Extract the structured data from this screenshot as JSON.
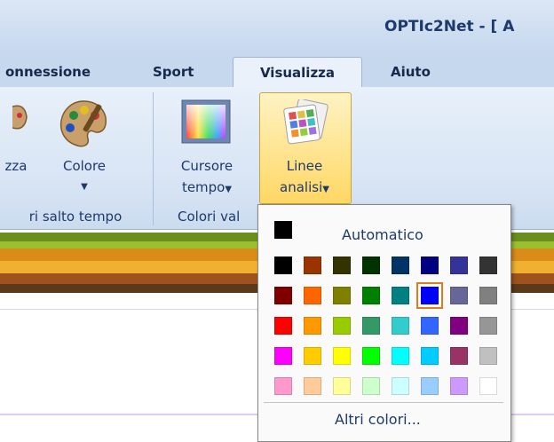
{
  "window": {
    "title": "OPTIc2Net - [ A"
  },
  "tabs": [
    {
      "label": "onnessione",
      "active": false
    },
    {
      "label": "Sport",
      "active": false
    },
    {
      "label": "Visualizza",
      "active": true
    },
    {
      "label": "Aiuto",
      "active": false
    }
  ],
  "ribbon": {
    "buttons": {
      "partial": "zza",
      "colore": "Colore",
      "cursore_line1": "Cursore",
      "cursore_line2": "tempo",
      "linee_line1": "Linee",
      "linee_line2": "analisi"
    },
    "groups": {
      "salto": "ri salto tempo",
      "colori": "Colori val"
    }
  },
  "color_popup": {
    "automatic_label": "Automatico",
    "more_colors_label": "Altri colori...",
    "automatic_color": "#000000",
    "selected_color": "#0000FF",
    "rows": [
      [
        "#000000",
        "#993300",
        "#333300",
        "#003300",
        "#003366",
        "#000080",
        "#333399",
        "#333333"
      ],
      [
        "#800000",
        "#FF6600",
        "#808000",
        "#008000",
        "#008080",
        "#0000FF",
        "#666699",
        "#808080"
      ],
      [
        "#FF0000",
        "#FF9900",
        "#99CC00",
        "#339966",
        "#33CCCC",
        "#3366FF",
        "#800080",
        "#969696"
      ],
      [
        "#FF00FF",
        "#FFCC00",
        "#FFFF00",
        "#00FF00",
        "#00FFFF",
        "#00CCFF",
        "#993366",
        "#C0C0C0"
      ],
      [
        "#FF99CC",
        "#FFCC99",
        "#FFFF99",
        "#CCFFCC",
        "#CCFFFF",
        "#99CCFF",
        "#CC99FF",
        "#FFFFFF"
      ]
    ]
  },
  "stripe_colors": [
    "#6b8f1e",
    "#9bbf2e",
    "#d98c1a",
    "#f0b030",
    "#a0521e",
    "#5a3a1a"
  ]
}
